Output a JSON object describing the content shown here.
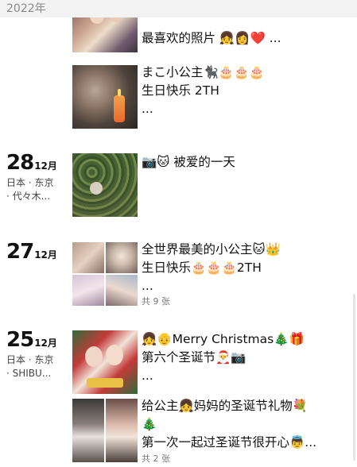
{
  "year_header": "2022年",
  "entries": [
    {
      "day": "",
      "month": "",
      "location": [],
      "lines": [
        "最喜欢的照片 👧👩❤️ ..."
      ],
      "count": ""
    },
    {
      "day": "",
      "month": "",
      "location": [],
      "lines": [
        "まこ小公主🐈‍⬛🎂🎂🎂",
        "生日快乐 2TH",
        "..."
      ],
      "count": ""
    },
    {
      "day": "28",
      "month": "12月",
      "location": [
        "日本 · 东京",
        "· 代々木..."
      ],
      "lines": [
        "📷🐱 被爱的一天"
      ],
      "count": ""
    },
    {
      "day": "27",
      "month": "12月",
      "location": [],
      "lines": [
        "全世界最美的小公主🐱👑",
        "生日快乐🎂🎂🎂2TH",
        "..."
      ],
      "count": "共 9 张"
    },
    {
      "day": "25",
      "month": "12月",
      "location": [
        "日本 · 东京",
        "· SHIBU..."
      ],
      "lines": [
        "👧👴Merry Christmas🎄🎁",
        "第六个圣诞节🎅📷",
        "..."
      ],
      "count": ""
    },
    {
      "day": "",
      "month": "",
      "location": [],
      "lines": [
        "给公主👧妈妈的圣诞节礼物💐",
        "🎄",
        "第一次一起过圣诞节很开心👼..."
      ],
      "count": "共 2 张"
    }
  ]
}
